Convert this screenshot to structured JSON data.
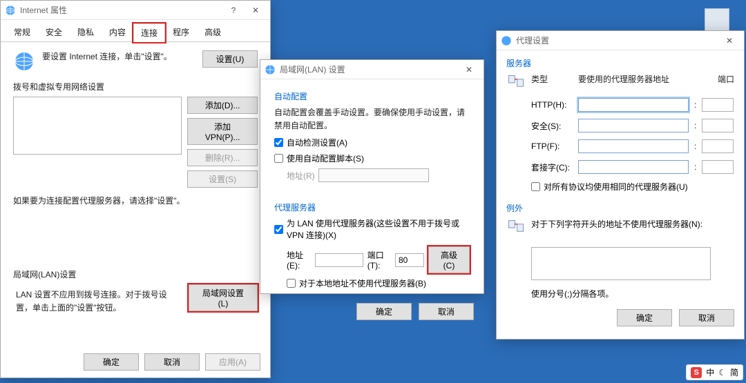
{
  "inet": {
    "title": "Internet 属性",
    "tabs": [
      "常规",
      "安全",
      "隐私",
      "内容",
      "连接",
      "程序",
      "高级"
    ],
    "line_setup": "要设置 Internet 连接，单击\"设置\"。",
    "btn_setup": "设置(U)",
    "section_dialup": "拨号和虚拟专用网络设置",
    "btn_add": "添加(D)...",
    "btn_add_vpn": "添加 VPN(P)...",
    "btn_remove": "删除(R)...",
    "btn_settings": "设置(S)",
    "hint_proxy": "如果要为连接配置代理服务器，请选择\"设置\"。",
    "section_lan": "局域网(LAN)设置",
    "lan_note": "LAN 设置不应用到拨号连接。对于拨号设置，单击上面的\"设置\"按钮。",
    "btn_lan": "局域网设置(L)",
    "btn_ok": "确定",
    "btn_cancel": "取消",
    "btn_apply": "应用(A)"
  },
  "lan": {
    "title": "局域网(LAN) 设置",
    "grp_auto": "自动配置",
    "auto_text": "自动配置会覆盖手动设置。要确保使用手动设置，请禁用自动配置。",
    "chk_autodetect": "自动检测设置(A)",
    "chk_autoscript": "使用自动配置脚本(S)",
    "lbl_address": "地址(R)",
    "grp_proxy": "代理服务器",
    "chk_useproxy": "为 LAN 使用代理服务器(这些设置不用于拨号或 VPN 连接)(X)",
    "lbl_addr": "地址(E):",
    "val_addr": "",
    "lbl_port": "端口(T):",
    "val_port": "80",
    "btn_advanced": "高级(C)",
    "chk_bypass": "对于本地地址不使用代理服务器(B)",
    "btn_ok": "确定",
    "btn_cancel": "取消"
  },
  "proxy": {
    "title": "代理设置",
    "grp_server": "服务器",
    "col_type": "类型",
    "col_addr": "要使用的代理服务器地址",
    "col_port": "端口",
    "rows": {
      "http": {
        "label": "HTTP(H):",
        "addr": "",
        "port": ""
      },
      "secure": {
        "label": "安全(S):",
        "addr": "",
        "port": ""
      },
      "ftp": {
        "label": "FTP(F):",
        "addr": "",
        "port": ""
      },
      "socks": {
        "label": "套接字(C):",
        "addr": "",
        "port": ""
      }
    },
    "chk_same": "对所有协议均使用相同的代理服务器(U)",
    "grp_excp": "例外",
    "excp_text": "对于下列字符开头的地址不使用代理服务器(N):",
    "excp_value": "",
    "excp_hint": "使用分号(;)分隔各项。",
    "btn_ok": "确定",
    "btn_cancel": "取消"
  },
  "ime": {
    "label": "中",
    "mode": "简"
  }
}
